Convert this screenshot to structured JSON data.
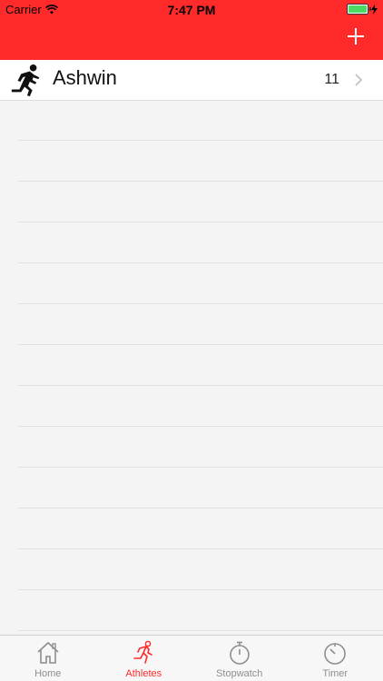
{
  "status_bar": {
    "carrier": "Carrier",
    "time": "7:47 PM",
    "battery_color": "#4cd964"
  },
  "nav_bar": {
    "background_color": "#ff2b2b",
    "add_icon": "plus-icon"
  },
  "athletes": [
    {
      "name": "Ashwin",
      "count": "11",
      "icon": "runner-icon"
    }
  ],
  "tabs": [
    {
      "label": "Home",
      "icon": "home-icon",
      "active": false
    },
    {
      "label": "Athletes",
      "icon": "runner-icon",
      "active": true
    },
    {
      "label": "Stopwatch",
      "icon": "stopwatch-icon",
      "active": false
    },
    {
      "label": "Timer",
      "icon": "timer-icon",
      "active": false
    }
  ],
  "colors": {
    "accent": "#ff2b2b",
    "inactive": "#8e8e8e"
  }
}
